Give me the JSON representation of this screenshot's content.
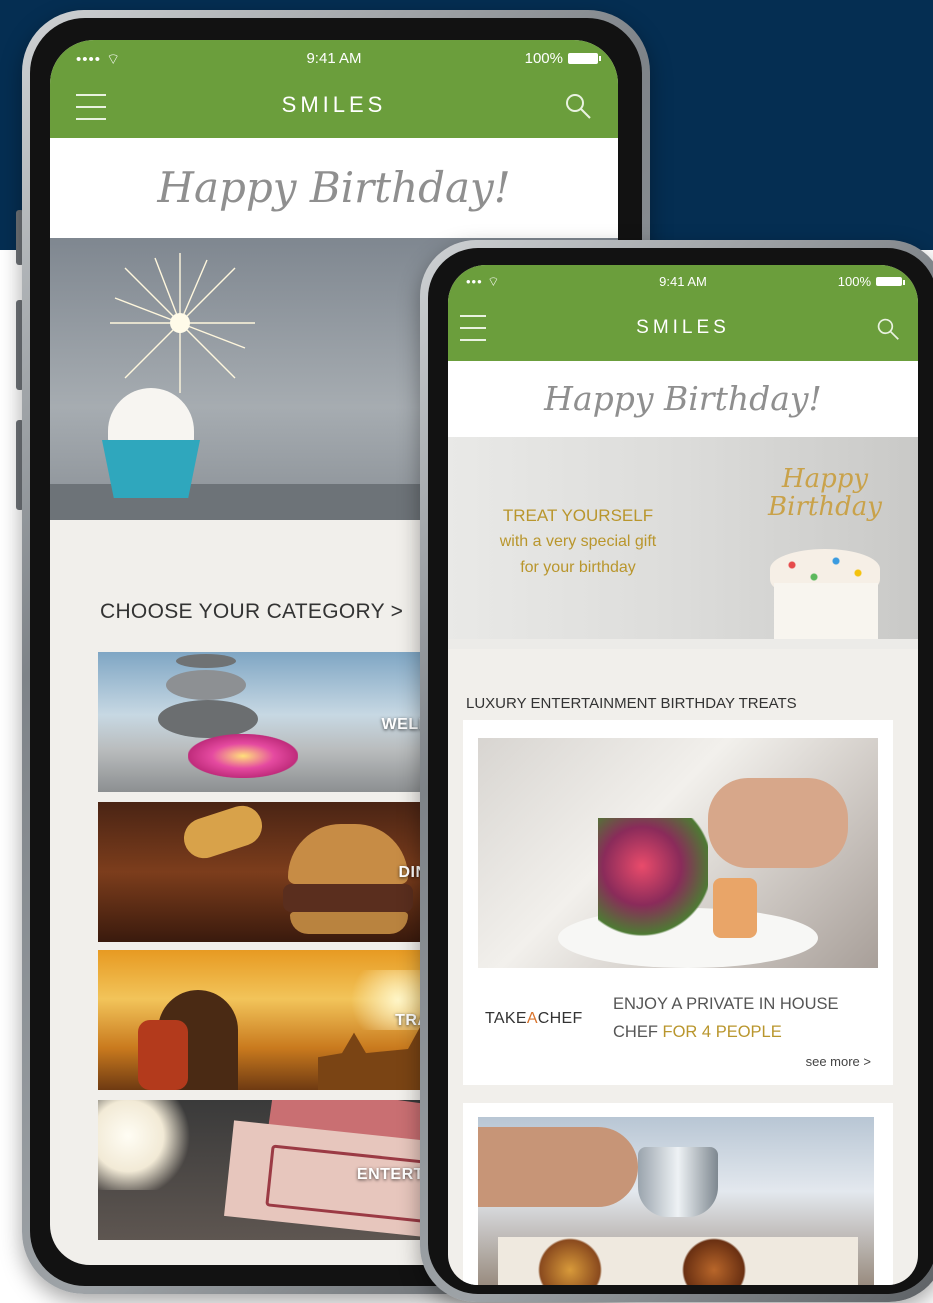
{
  "status": {
    "signal": "•••• ",
    "time": "9:41 AM",
    "battery": "100%"
  },
  "app": {
    "brand": "SMILES"
  },
  "greeting": "Happy Birthday!",
  "phone_left": {
    "hero": {
      "line1": "TREAT Y",
      "line2": "with a ver",
      "line3": "for you"
    },
    "categories_heading": "CHOOSE YOUR CATEGORY >",
    "categories": [
      {
        "label": "WELLNESS"
      },
      {
        "label": "DINING"
      },
      {
        "label": "TRAVEL"
      },
      {
        "label": "ENTERTAINMENT"
      }
    ]
  },
  "phone_right": {
    "hero": {
      "line1": "TREAT YOURSELF",
      "line2": "with a very special gift",
      "line3": "for your birthday",
      "cake_topper_1": "Happy",
      "cake_topper_2": "Birthday"
    },
    "section_heading": "LUXURY ENTERTAINMENT BIRTHDAY TREATS",
    "offer": {
      "partner_a": "TAKE",
      "partner_b": "A",
      "partner_c": "CHEF",
      "title_1": "ENJOY A PRIVATE IN HOUSE",
      "title_2": "CHEF",
      "title_3": "FOR 4 PEOPLE",
      "see_more": "see more >"
    }
  },
  "colors": {
    "brand_green": "#6b9e3c",
    "navy": "#052e52",
    "accent_gold": "#b9962d"
  }
}
